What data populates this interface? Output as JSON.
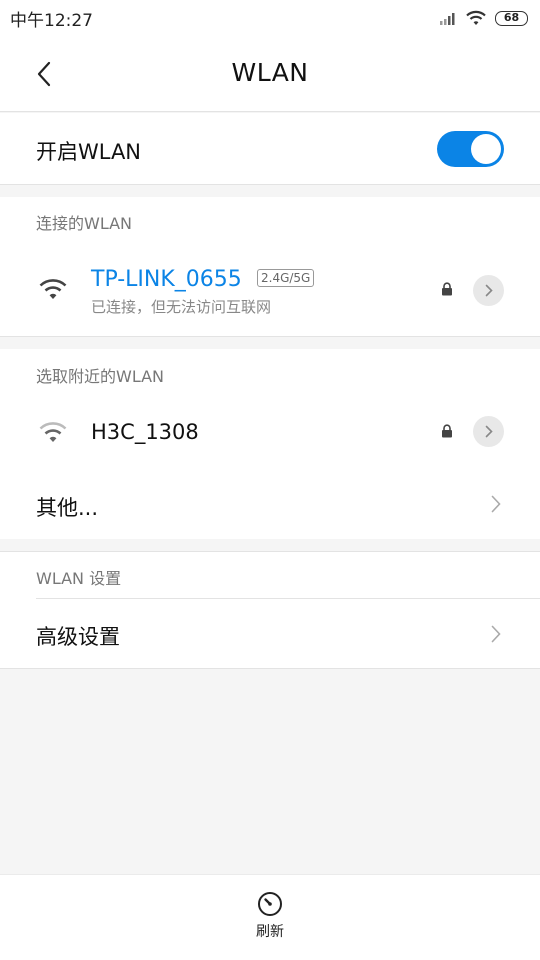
{
  "status_bar": {
    "time": "中午12:27",
    "battery": "68"
  },
  "header": {
    "title": "WLAN"
  },
  "wlan_toggle": {
    "label": "开启WLAN",
    "enabled": true,
    "accent_color": "#0b84e6"
  },
  "connected_section": {
    "header": "连接的WLAN",
    "network": {
      "ssid": "TP-LINK_0655",
      "band": "2.4G/5G",
      "status": "已连接，但无法访问互联网",
      "icon": "wifi-icon",
      "secured": true
    }
  },
  "nearby_section": {
    "header": "选取附近的WLAN",
    "networks": [
      {
        "ssid": "H3C_1308",
        "icon": "wifi-icon",
        "secured": true
      }
    ],
    "other_label": "其他..."
  },
  "settings_section": {
    "header": "WLAN 设置",
    "advanced_label": "高级设置"
  },
  "bottom_bar": {
    "refresh_label": "刷新"
  }
}
